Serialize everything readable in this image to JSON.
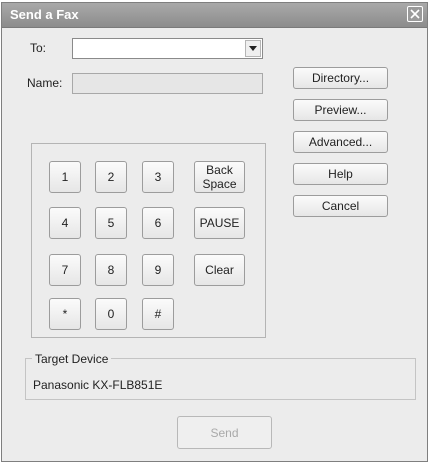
{
  "window": {
    "title": "Send a Fax"
  },
  "form": {
    "to_label": "To:",
    "to_value": "",
    "name_label": "Name:",
    "name_value": ""
  },
  "keypad": {
    "rows": [
      [
        "1",
        "2",
        "3"
      ],
      [
        "4",
        "5",
        "6"
      ],
      [
        "7",
        "8",
        "9"
      ],
      [
        "*",
        "0",
        "#"
      ]
    ],
    "backspace_line1": "Back",
    "backspace_line2": "Space",
    "pause": "PAUSE",
    "clear": "Clear"
  },
  "side_buttons": {
    "directory": "Directory...",
    "preview": "Preview...",
    "advanced": "Advanced...",
    "help": "Help",
    "cancel": "Cancel"
  },
  "target_device": {
    "group_label": "Target Device",
    "value": "Panasonic KX-FLB851E"
  },
  "send_label": "Send"
}
